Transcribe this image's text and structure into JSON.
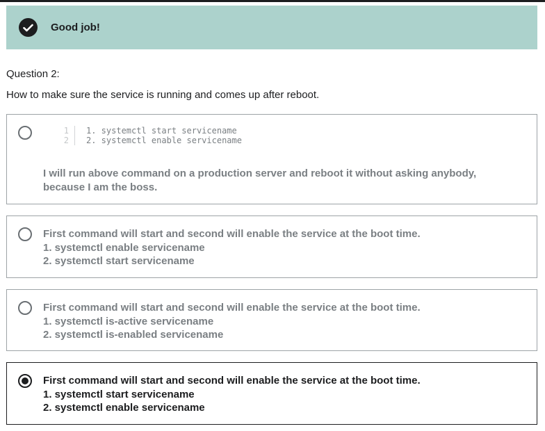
{
  "banner": {
    "icon": "check-circle-icon",
    "text": "Good job!"
  },
  "question": {
    "number": "Question 2:",
    "text": "How to make sure the service is running and comes up after reboot."
  },
  "options": [
    {
      "code": {
        "line_numbers": [
          "1",
          "2"
        ],
        "lines": [
          "1. systemctl start servicename",
          "2. systemctl enable servicename"
        ]
      },
      "note": "I will run above command on a production server and reboot it without asking anybody, because I am the boss.",
      "selected": false
    },
    {
      "lines": [
        "First command will start and second will enable the service at the boot time.",
        "1. systemctl enable servicename",
        "2. systemctl start servicename"
      ],
      "selected": false
    },
    {
      "lines": [
        "First command will start and second will enable the service at the boot time.",
        "1. systemctl is-active servicename",
        "2. systemctl is-enabled servicename"
      ],
      "selected": false
    },
    {
      "lines": [
        "First command will start and second will enable the service at the boot time.",
        "1. systemctl start servicename",
        "2. systemctl enable servicename"
      ],
      "selected": true
    }
  ],
  "colors": {
    "banner_bg": "#acd2cc",
    "text_dark": "#1c1d1f",
    "text_muted": "#7a7f83",
    "border": "#9da3a6"
  }
}
